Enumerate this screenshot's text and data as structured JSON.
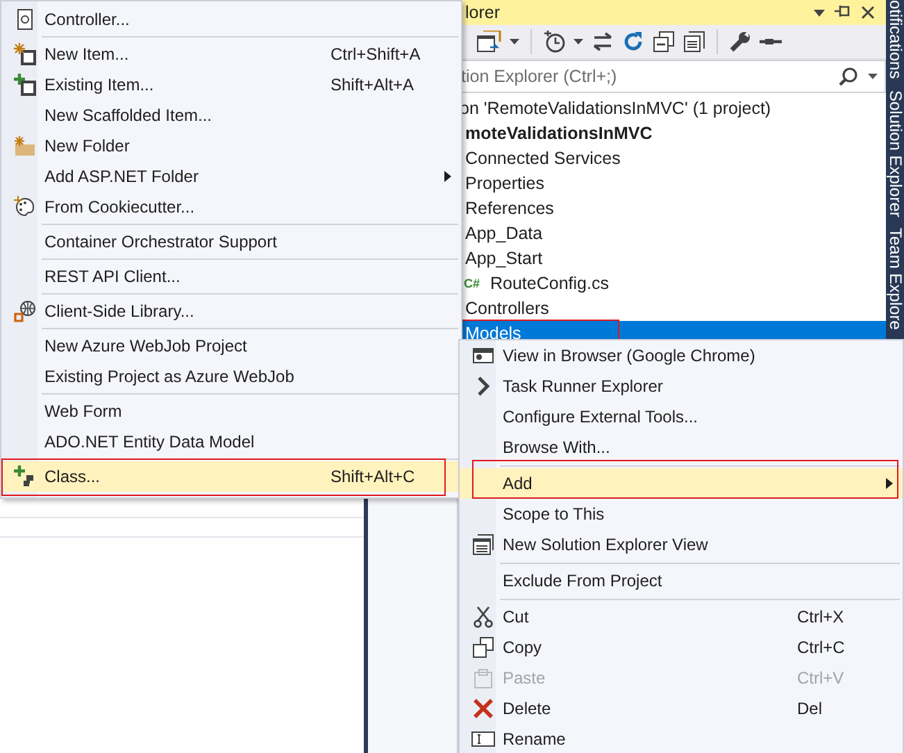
{
  "add_menu": {
    "items": [
      {
        "kind": "item",
        "label": "Controller...",
        "submenu": false,
        "selected": false,
        "marked": false
      },
      {
        "kind": "separator"
      },
      {
        "kind": "item",
        "label": "New Item...",
        "shortcut": "Ctrl+Shift+A",
        "submenu": false,
        "selected": false,
        "marked": false
      },
      {
        "kind": "item",
        "label": "Existing Item...",
        "shortcut": "Shift+Alt+A",
        "submenu": false,
        "selected": false,
        "marked": false
      },
      {
        "kind": "item",
        "label": "New Scaffolded Item...",
        "submenu": false,
        "selected": false,
        "marked": false
      },
      {
        "kind": "item",
        "label": "New Folder",
        "submenu": false,
        "selected": false,
        "marked": false
      },
      {
        "kind": "item",
        "label": "Add ASP.NET Folder",
        "submenu": true,
        "selected": false,
        "marked": false
      },
      {
        "kind": "item",
        "label": "From Cookiecutter...",
        "submenu": false,
        "selected": false,
        "marked": false
      },
      {
        "kind": "separator"
      },
      {
        "kind": "item",
        "label": "Container Orchestrator Support",
        "submenu": false,
        "selected": false,
        "marked": false
      },
      {
        "kind": "separator"
      },
      {
        "kind": "item",
        "label": "REST API Client...",
        "submenu": false,
        "selected": false,
        "marked": false
      },
      {
        "kind": "separator"
      },
      {
        "kind": "item",
        "label": "Client-Side Library...",
        "submenu": false,
        "selected": false,
        "marked": false
      },
      {
        "kind": "separator"
      },
      {
        "kind": "item",
        "label": "New Azure WebJob Project",
        "submenu": false,
        "selected": false,
        "marked": false
      },
      {
        "kind": "item",
        "label": "Existing Project as Azure WebJob",
        "submenu": false,
        "selected": false,
        "marked": false
      },
      {
        "kind": "separator"
      },
      {
        "kind": "item",
        "label": "Web Form",
        "submenu": false,
        "selected": false,
        "marked": false
      },
      {
        "kind": "item",
        "label": "ADO.NET Entity Data Model",
        "submenu": false,
        "selected": false,
        "marked": false
      },
      {
        "kind": "separator"
      },
      {
        "kind": "item",
        "label": "Class...",
        "shortcut": "Shift+Alt+C",
        "submenu": false,
        "selected": true,
        "marked": true
      }
    ]
  },
  "solution_explorer": {
    "title": "lorer",
    "search": {
      "placeholder": "tion Explorer (Ctrl+;)"
    },
    "tree": [
      {
        "label": "on 'RemoteValidationsInMVC' (1 project)",
        "selected": false,
        "marked": false,
        "children": [
          {
            "label": "moteValidationsInMVC",
            "selected": false,
            "marked": false,
            "children": [
              {
                "label": "Connected Services",
                "selected": false,
                "marked": false
              },
              {
                "label": "Properties",
                "selected": false,
                "marked": false
              },
              {
                "label": "References",
                "selected": false,
                "marked": false
              },
              {
                "label": "App_Data",
                "selected": false,
                "marked": false
              },
              {
                "label": "App_Start",
                "selected": false,
                "marked": false,
                "children": [
                  {
                    "label": "RouteConfig.cs",
                    "badge": "C#",
                    "selected": false,
                    "marked": false
                  }
                ]
              },
              {
                "label": "Controllers",
                "selected": false,
                "marked": false
              },
              {
                "label": "Models",
                "selected": true,
                "marked": true
              }
            ]
          }
        ]
      }
    ]
  },
  "side_tabs": [
    "otifications",
    "Solution Explorer",
    "Team Explore"
  ],
  "context_menu": {
    "items": [
      {
        "kind": "item",
        "label": "View in Browser (Google Chrome)",
        "submenu": false,
        "selected": false,
        "marked": false,
        "disabled": false
      },
      {
        "kind": "item",
        "label": "Task Runner Explorer",
        "submenu": false,
        "selected": false,
        "marked": false,
        "disabled": false
      },
      {
        "kind": "item",
        "label": "Configure External Tools...",
        "submenu": false,
        "selected": false,
        "marked": false,
        "disabled": false
      },
      {
        "kind": "item",
        "label": "Browse With...",
        "submenu": false,
        "selected": false,
        "marked": false,
        "disabled": false
      },
      {
        "kind": "separator"
      },
      {
        "kind": "item",
        "label": "Add",
        "submenu": true,
        "selected": true,
        "marked": true,
        "disabled": false
      },
      {
        "kind": "item",
        "label": "Scope to This",
        "submenu": false,
        "selected": false,
        "marked": false,
        "disabled": false
      },
      {
        "kind": "item",
        "label": "New Solution Explorer View",
        "submenu": false,
        "selected": false,
        "marked": false,
        "disabled": false
      },
      {
        "kind": "separator"
      },
      {
        "kind": "item",
        "label": "Exclude From Project",
        "submenu": false,
        "selected": false,
        "marked": false,
        "disabled": false
      },
      {
        "kind": "separator"
      },
      {
        "kind": "item",
        "label": "Cut",
        "shortcut": "Ctrl+X",
        "submenu": false,
        "selected": false,
        "marked": false,
        "disabled": false
      },
      {
        "kind": "item",
        "label": "Copy",
        "shortcut": "Ctrl+C",
        "submenu": false,
        "selected": false,
        "marked": false,
        "disabled": false
      },
      {
        "kind": "item",
        "label": "Paste",
        "shortcut": "Ctrl+V",
        "submenu": false,
        "selected": false,
        "marked": false,
        "disabled": true
      },
      {
        "kind": "item",
        "label": "Delete",
        "shortcut": "Del",
        "submenu": false,
        "selected": false,
        "marked": false,
        "disabled": false
      },
      {
        "kind": "item",
        "label": "Rename",
        "submenu": false,
        "selected": false,
        "marked": false,
        "disabled": false
      }
    ]
  }
}
